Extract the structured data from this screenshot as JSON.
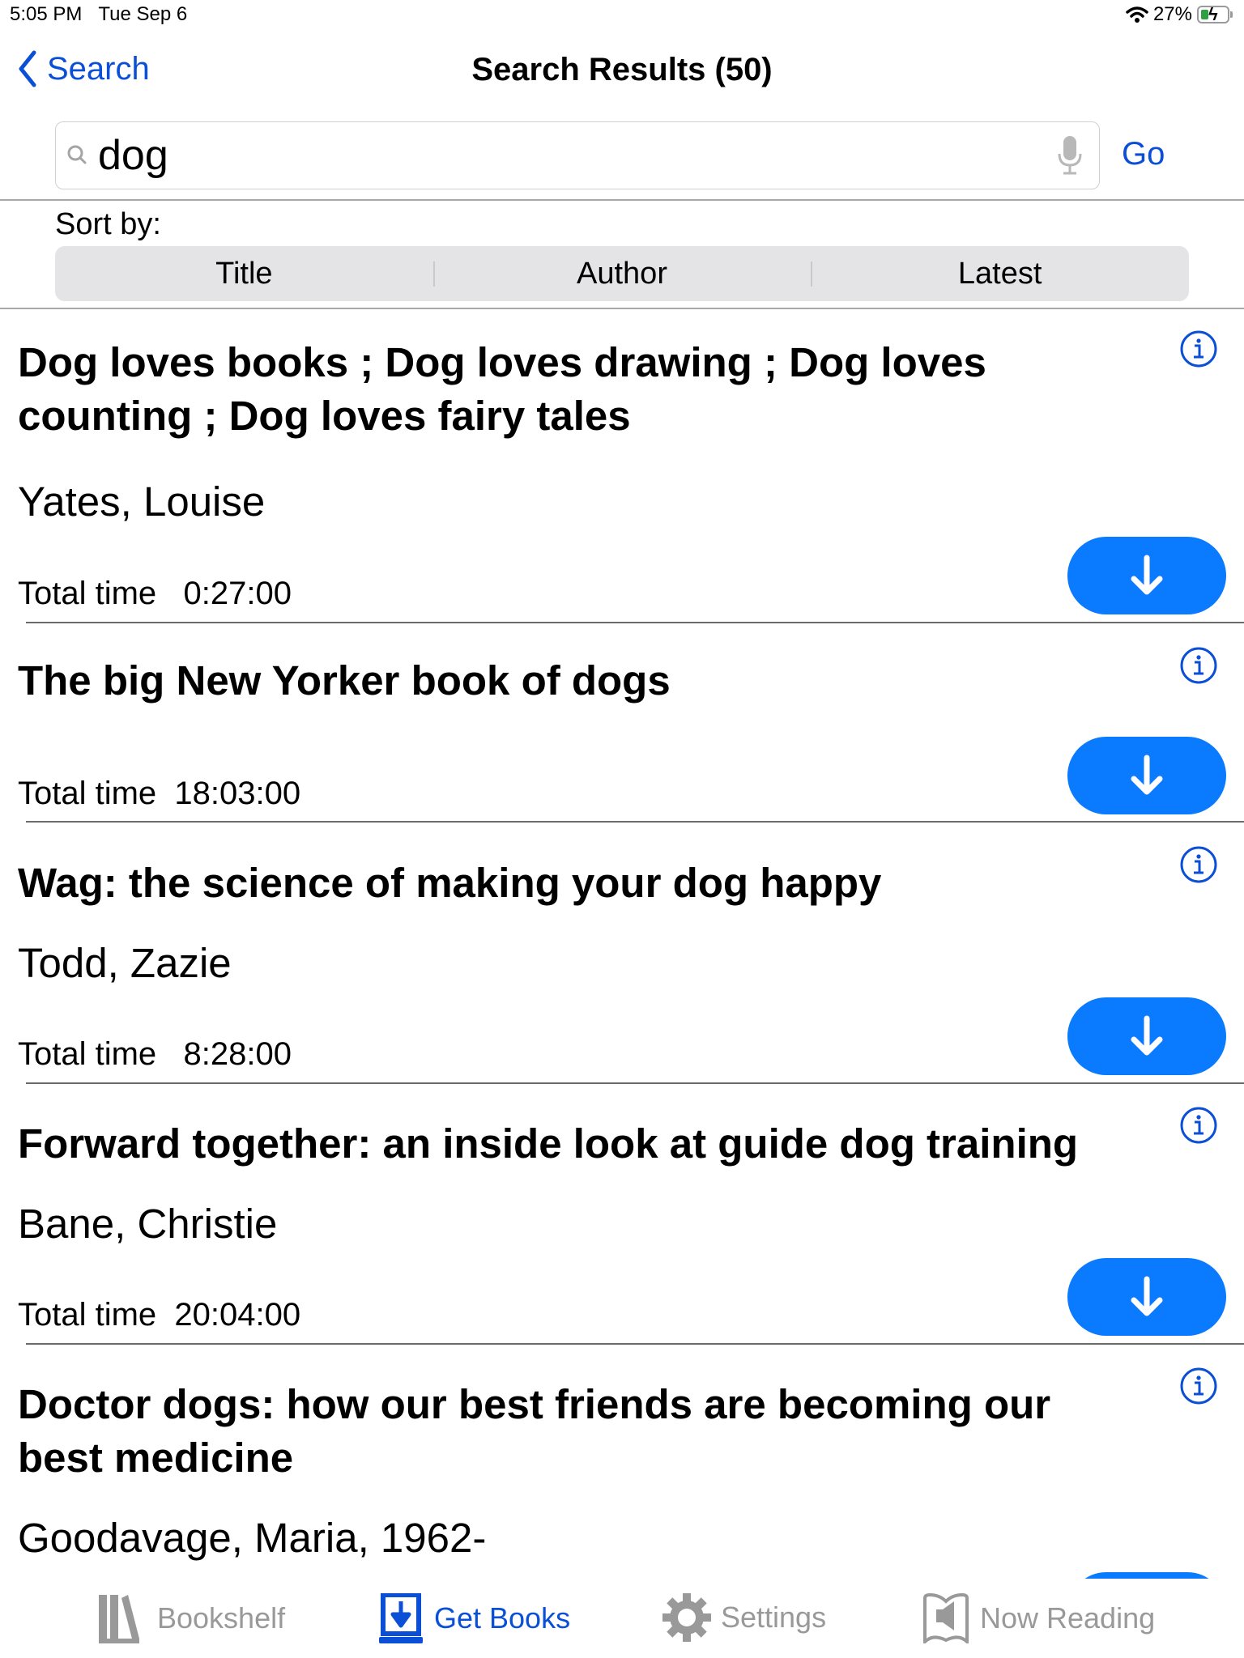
{
  "status_bar": {
    "time": "5:05 PM",
    "date": "Tue Sep 6",
    "battery_percent": "27%",
    "battery_level": 0.27,
    "charging": true,
    "icons": [
      "wifi-icon",
      "battery-charging-icon"
    ]
  },
  "nav": {
    "back_label": "Search",
    "title": "Search Results (50)"
  },
  "search": {
    "value": "dog",
    "placeholder": "",
    "go_label": "Go"
  },
  "sort": {
    "label": "Sort by:",
    "options": [
      "Title",
      "Author",
      "Latest"
    ]
  },
  "results": [
    {
      "title": "Dog loves books ; Dog loves drawing ; Dog loves counting ; Dog loves fairy tales",
      "author": "Yates, Louise",
      "time_label": "Total time",
      "time": "0:27:00"
    },
    {
      "title": "The big New Yorker book of dogs",
      "author": "",
      "time_label": "Total time",
      "time": "18:03:00"
    },
    {
      "title": "Wag: the science of making your dog happy",
      "author": "Todd, Zazie",
      "time_label": "Total time",
      "time": "8:28:00"
    },
    {
      "title": "Forward together: an inside look at guide dog training",
      "author": "Bane, Christie",
      "time_label": "Total time",
      "time": "20:04:00"
    },
    {
      "title": "Doctor dogs: how our best friends are becoming our best medicine",
      "author": "Goodavage, Maria, 1962-",
      "time_label": "",
      "time": ""
    }
  ],
  "tab_bar": {
    "tabs": [
      {
        "label": "Bookshelf",
        "icon": "bookshelf-icon",
        "active": false
      },
      {
        "label": "Get Books",
        "icon": "get-books-icon",
        "active": true
      },
      {
        "label": "Settings",
        "icon": "gear-icon",
        "active": false
      },
      {
        "label": "Now Reading",
        "icon": "now-reading-icon",
        "active": false
      }
    ]
  },
  "colors": {
    "accent": "#0a4fd6",
    "download_button": "#0a7aff",
    "inactive_tab": "#999999"
  }
}
